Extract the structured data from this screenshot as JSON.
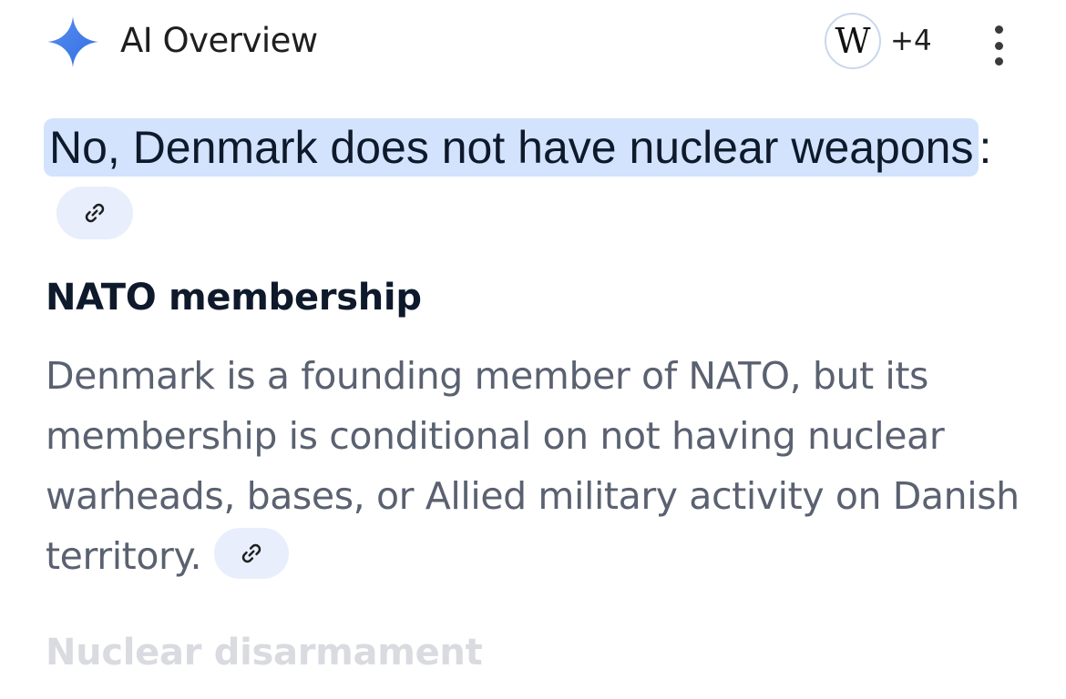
{
  "header": {
    "title": "AI Overview",
    "sparkle_icon": "gemini-sparkle-icon",
    "source_icon": "wikipedia-icon",
    "source_icon_letter": "W",
    "source_count": "+4",
    "more_icon": "more-vert-icon"
  },
  "answer": {
    "highlighted_text": "No, Denmark does not have nuclear weapons",
    "trailing_punct": ":",
    "link_icon": "link-icon"
  },
  "section": {
    "heading": "NATO membership",
    "body": "Denmark is a founding member of NATO, but its membership is conditional on not having nuclear warheads, bases, or Allied military activity on Danish territory.",
    "link_icon": "link-icon"
  },
  "next_section": {
    "heading": "Nuclear disarmament"
  },
  "colors": {
    "accent_blue": "#4285f4",
    "highlight": "#d3e3fd",
    "chip_bg": "#e8eefc",
    "heading_text": "#0e1a2b",
    "body_text": "#5a6170",
    "faded_text": "#d9dbe0"
  }
}
